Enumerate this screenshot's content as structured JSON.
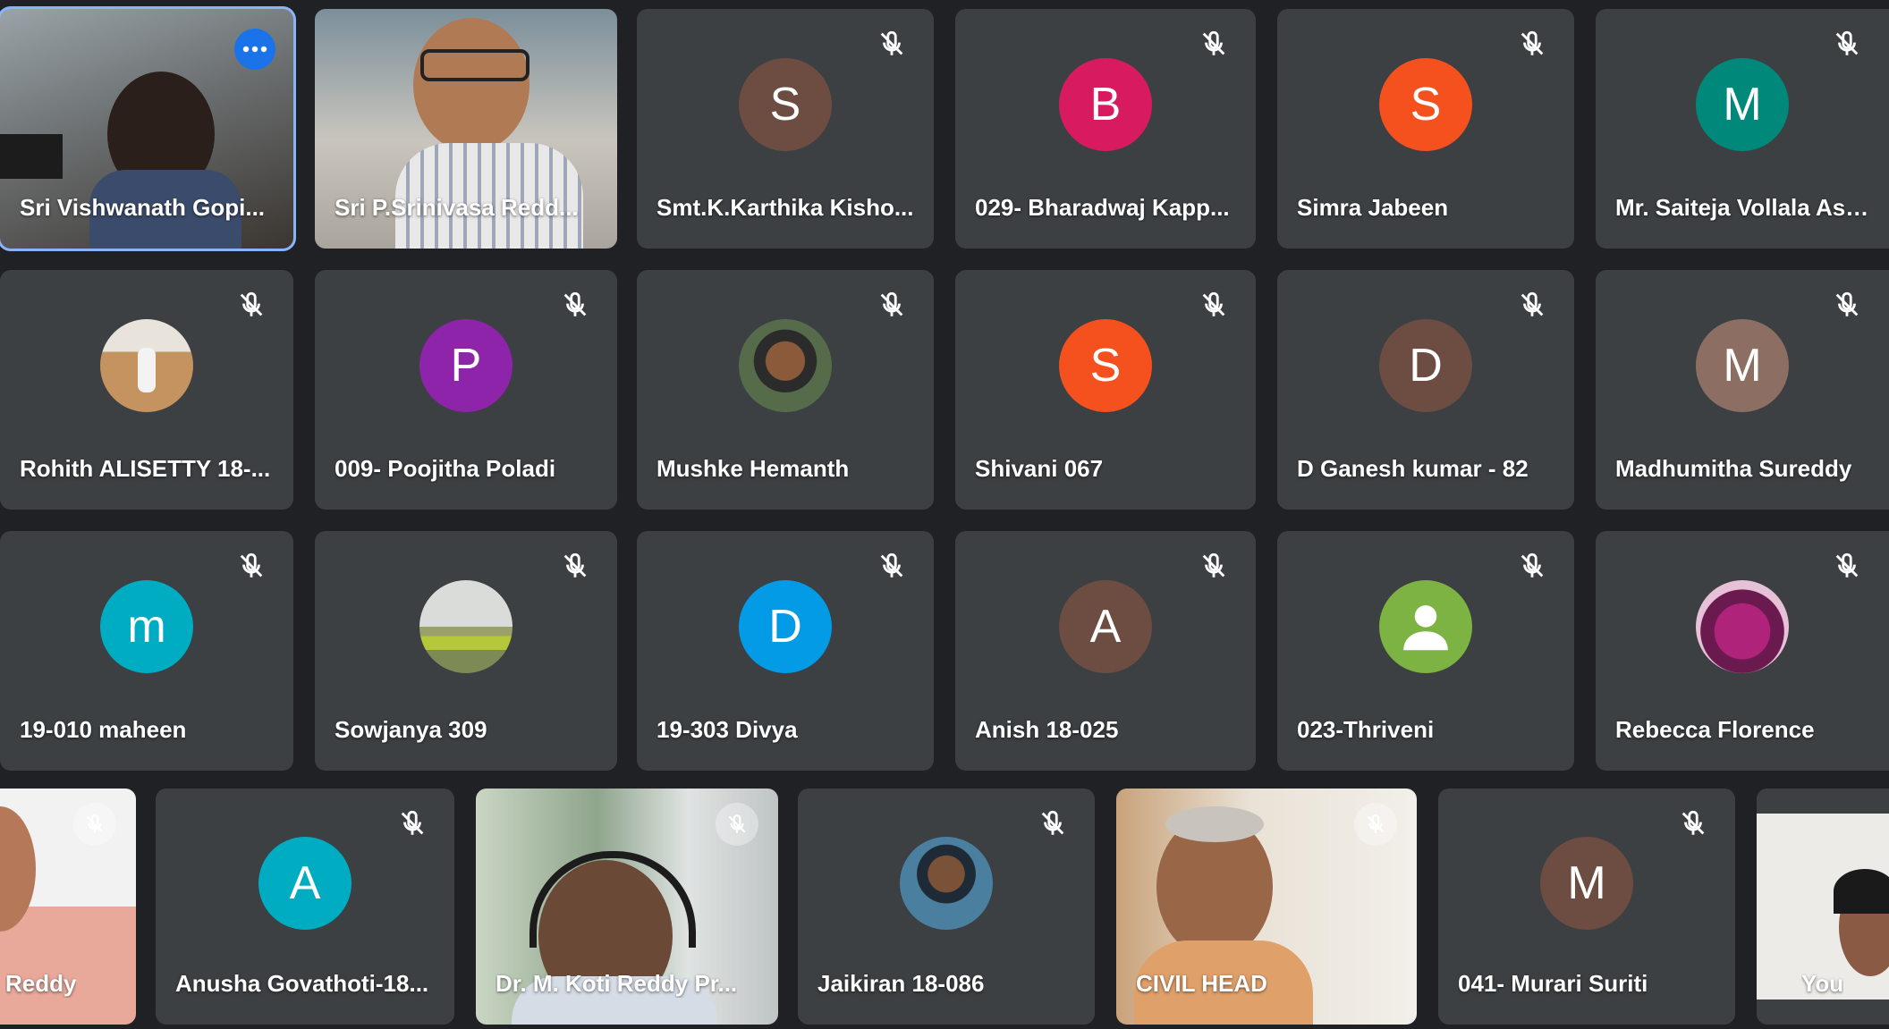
{
  "participants": [
    {
      "name": "Sri Vishwanath Gopi...",
      "type": "video",
      "active": true
    },
    {
      "name": "Sri P.Srinivasa Redd...",
      "type": "video"
    },
    {
      "name": "Smt.K.Karthika Kisho...",
      "type": "avatar",
      "letter": "S",
      "color": "#6d4c41"
    },
    {
      "name": "029- Bharadwaj Kapp...",
      "type": "avatar",
      "letter": "B",
      "color": "#d81b60"
    },
    {
      "name": "Simra Jabeen",
      "type": "avatar",
      "letter": "S",
      "color": "#f4511e"
    },
    {
      "name": "Mr. Saiteja Vollala Ass...",
      "type": "avatar",
      "letter": "M",
      "color": "#00897b"
    },
    {
      "name": "Rohith ALISETTY 18-...",
      "type": "photo"
    },
    {
      "name": "009- Poojitha Poladi",
      "type": "avatar",
      "letter": "P",
      "color": "#8e24aa"
    },
    {
      "name": "Mushke Hemanth",
      "type": "photo"
    },
    {
      "name": "Shivani 067",
      "type": "avatar",
      "letter": "S",
      "color": "#f4511e"
    },
    {
      "name": "D Ganesh kumar - 82",
      "type": "avatar",
      "letter": "D",
      "color": "#6d4c41"
    },
    {
      "name": "Madhumitha Sureddy",
      "type": "avatar",
      "letter": "M",
      "color": "#8d6e63"
    },
    {
      "name": "19-010 maheen",
      "type": "avatar",
      "letter": "m",
      "color": "#00acc1"
    },
    {
      "name": "Sowjanya 309",
      "type": "photo"
    },
    {
      "name": "19-303 Divya",
      "type": "avatar",
      "letter": "D",
      "color": "#039be5"
    },
    {
      "name": "Anish 18-025",
      "type": "avatar",
      "letter": "A",
      "color": "#6d4c41"
    },
    {
      "name": "023-Thriveni",
      "type": "avatar",
      "letter": "",
      "color": "#7cb342"
    },
    {
      "name": "Rebecca Florence",
      "type": "photo"
    },
    {
      "name": "Reddy",
      "type": "video"
    },
    {
      "name": "Anusha Govathoti-18...",
      "type": "avatar",
      "letter": "A",
      "color": "#00acc1"
    },
    {
      "name": "Dr. M. Koti Reddy Pr...",
      "type": "video"
    },
    {
      "name": "Jaikiran 18-086",
      "type": "photo"
    },
    {
      "name": "CIVIL HEAD",
      "type": "video"
    },
    {
      "name": "041- Murari Suriti",
      "type": "avatar",
      "letter": "M",
      "color": "#6d4c41"
    },
    {
      "name": "You",
      "type": "video"
    }
  ],
  "colors": {
    "background": "#202124",
    "tile": "#3c4043",
    "active_border": "#8ab4f8"
  }
}
